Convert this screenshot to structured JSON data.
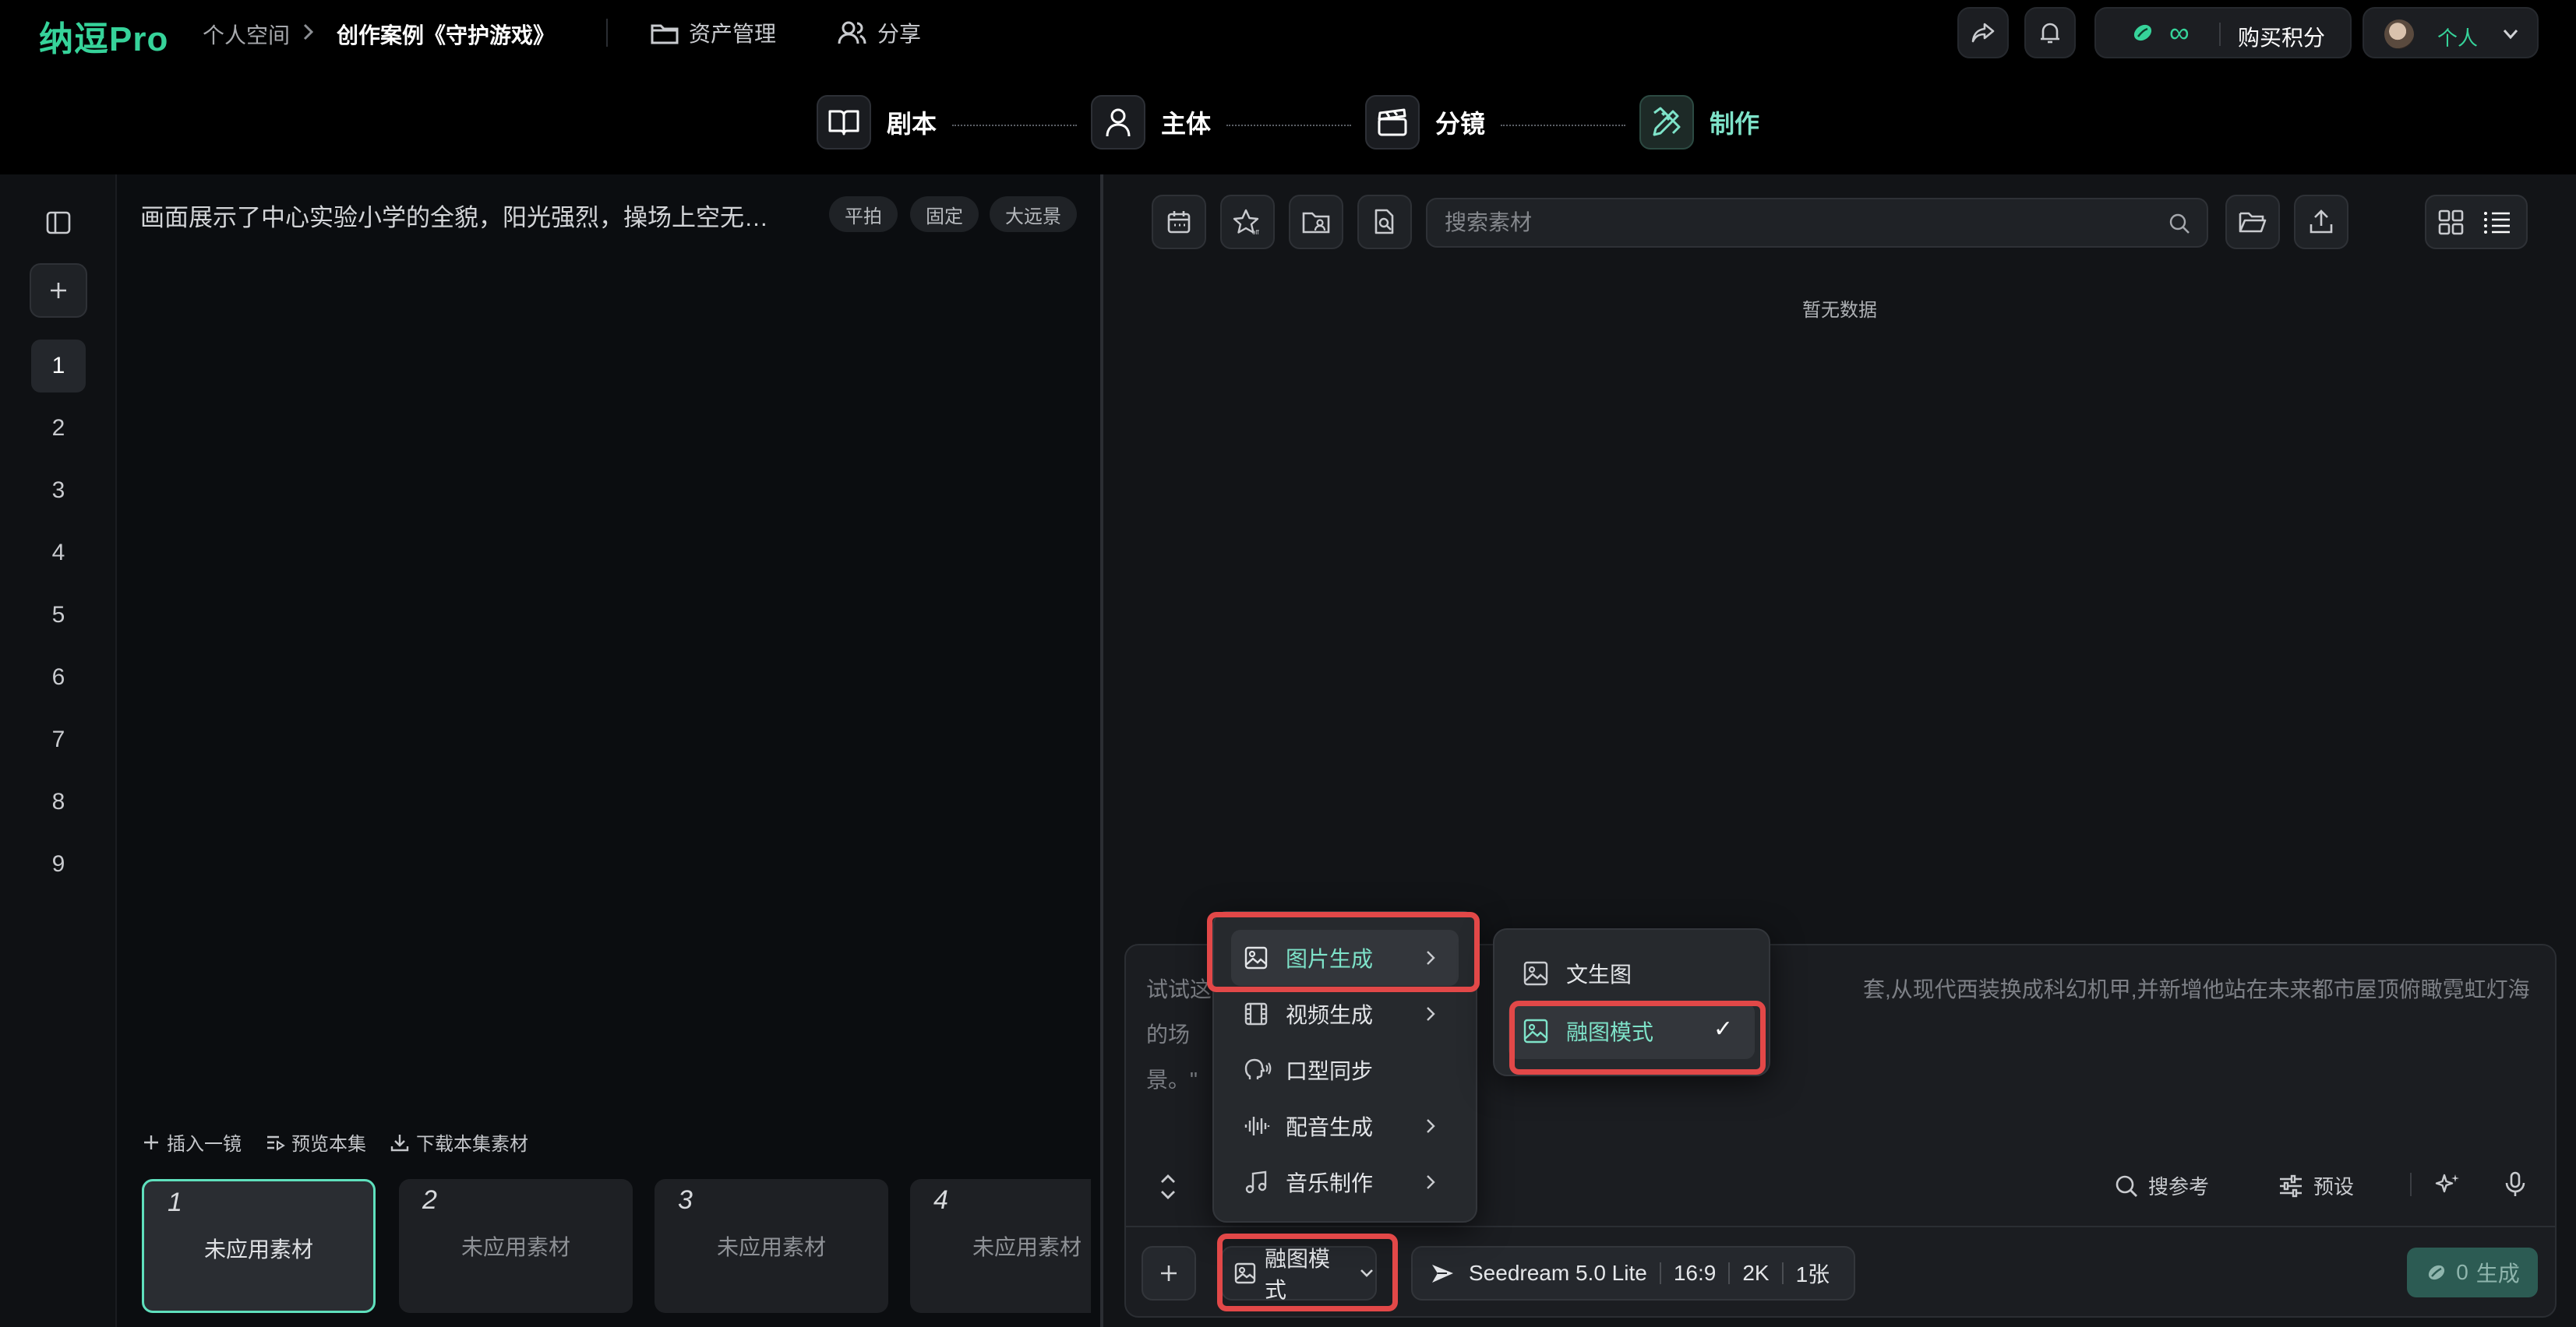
{
  "header": {
    "logo": "纳逗Pro",
    "breadcrumb": [
      "个人空间",
      "创作案例《守护游戏》"
    ],
    "nav": [
      {
        "label": "资产管理",
        "icon": "folder-icon"
      },
      {
        "label": "分享",
        "icon": "users-icon"
      }
    ],
    "credits_symbol": "∞",
    "buy_credits": "购买积分",
    "account_label": "个人"
  },
  "steps": [
    {
      "label": "剧本",
      "icon": "book-icon"
    },
    {
      "label": "主体",
      "icon": "person-icon"
    },
    {
      "label": "分镜",
      "icon": "clapperboard-icon"
    },
    {
      "label": "制作",
      "icon": "pen-ruler-icon",
      "active": true
    }
  ],
  "rail": {
    "active": "1",
    "shots": [
      "1",
      "2",
      "3",
      "4",
      "5",
      "6",
      "7",
      "8",
      "9"
    ]
  },
  "scene": {
    "description": "画面展示了中心实验小学的全貌，阳光强烈，操场上空无…",
    "tags": [
      "平拍",
      "固定",
      "大远景"
    ],
    "actions": [
      "插入一镜",
      "预览本集",
      "下载本集素材"
    ],
    "thumbs": [
      {
        "num": "1",
        "text": "未应用素材"
      },
      {
        "num": "2",
        "text": "未应用素材"
      },
      {
        "num": "3",
        "text": "未应用素材"
      },
      {
        "num": "4",
        "text": "未应用素材"
      }
    ]
  },
  "assets": {
    "search_placeholder": "搜索素材",
    "empty_text": "暂无数据"
  },
  "composer": {
    "prompt_start": "试试这",
    "prompt_mid": "的",
    "prompt_end": "套,从现代西装换成科幻机甲,并新增他站在未来都市屋顶俯瞰霓虹灯海的场",
    "prompt_line2": "景。\"",
    "search_ref": "搜参考",
    "preset": "预设",
    "mode_button": "融图模式",
    "model": "Seedream 5.0 Lite",
    "ratio": "16:9",
    "resolution": "2K",
    "count": "1张",
    "generate_count": "0",
    "generate_label": "生成"
  },
  "menu": {
    "items": [
      {
        "label": "图片生成",
        "icon": "image-icon",
        "submenu": true,
        "active": true
      },
      {
        "label": "视频生成",
        "icon": "film-icon",
        "submenu": true
      },
      {
        "label": "口型同步",
        "icon": "lip-sync-icon",
        "submenu": false
      },
      {
        "label": "配音生成",
        "icon": "waveform-icon",
        "submenu": true
      },
      {
        "label": "音乐制作",
        "icon": "music-icon",
        "submenu": true
      }
    ],
    "submenu": [
      {
        "label": "文生图",
        "icon": "image-icon"
      },
      {
        "label": "融图模式",
        "icon": "image-icon",
        "selected": true,
        "check": "✓"
      }
    ]
  },
  "colors": {
    "accent": "#36d39a",
    "highlight": "#e24848",
    "active_text": "#7ee3c9"
  }
}
